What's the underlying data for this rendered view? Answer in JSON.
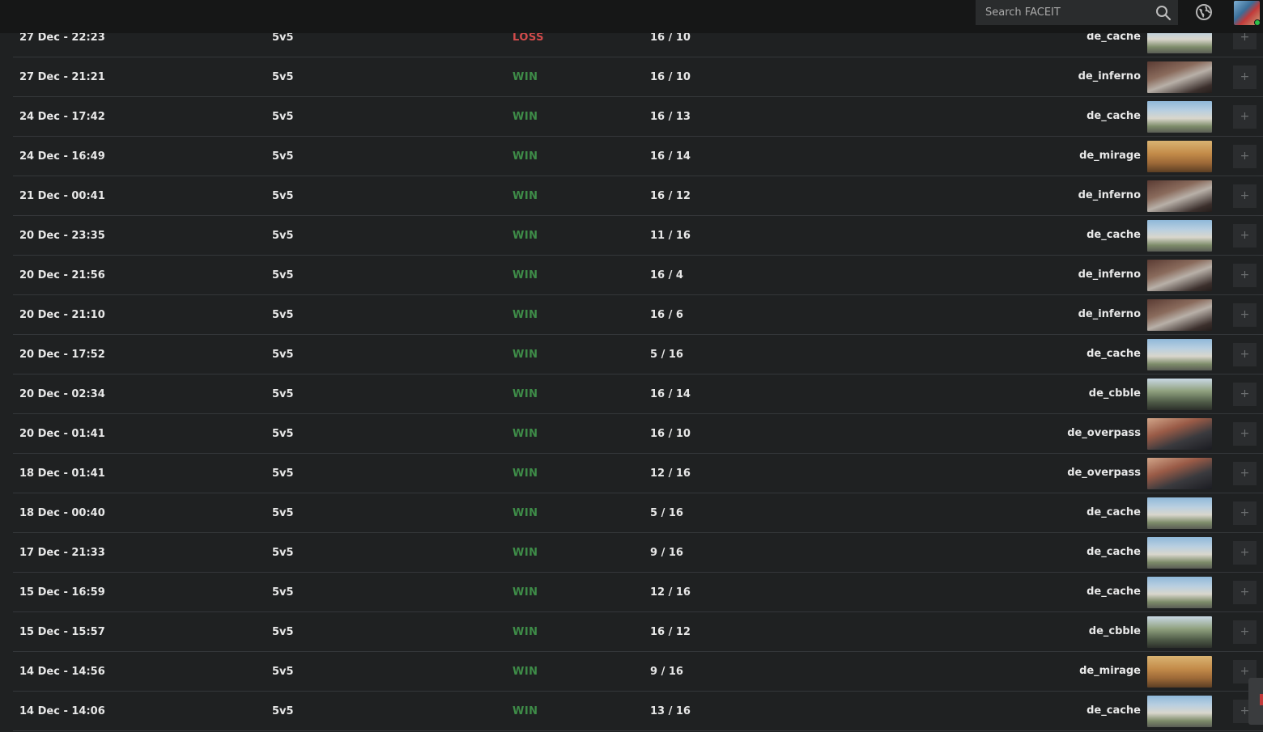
{
  "search": {
    "placeholder": "Search FACEIT"
  },
  "icons": {
    "search": "search-icon",
    "globe": "globe-icon",
    "plus": "plus-icon"
  },
  "colors": {
    "win": "#3e8c48",
    "loss": "#d24b4b"
  },
  "matches": [
    {
      "date": "27 Dec - 22:23",
      "mode": "5v5",
      "result": "LOSS",
      "score": "16 / 10",
      "map": "de_cache",
      "plus": "+"
    },
    {
      "date": "27 Dec - 21:21",
      "mode": "5v5",
      "result": "WIN",
      "score": "16 / 10",
      "map": "de_inferno",
      "plus": "+"
    },
    {
      "date": "24 Dec - 17:42",
      "mode": "5v5",
      "result": "WIN",
      "score": "16 / 13",
      "map": "de_cache",
      "plus": "+"
    },
    {
      "date": "24 Dec - 16:49",
      "mode": "5v5",
      "result": "WIN",
      "score": "16 / 14",
      "map": "de_mirage",
      "plus": "+"
    },
    {
      "date": "21 Dec - 00:41",
      "mode": "5v5",
      "result": "WIN",
      "score": "16 / 12",
      "map": "de_inferno",
      "plus": "+"
    },
    {
      "date": "20 Dec - 23:35",
      "mode": "5v5",
      "result": "WIN",
      "score": "11 / 16",
      "map": "de_cache",
      "plus": "+"
    },
    {
      "date": "20 Dec - 21:56",
      "mode": "5v5",
      "result": "WIN",
      "score": "16 / 4",
      "map": "de_inferno",
      "plus": "+"
    },
    {
      "date": "20 Dec - 21:10",
      "mode": "5v5",
      "result": "WIN",
      "score": "16 / 6",
      "map": "de_inferno",
      "plus": "+"
    },
    {
      "date": "20 Dec - 17:52",
      "mode": "5v5",
      "result": "WIN",
      "score": "5 / 16",
      "map": "de_cache",
      "plus": "+"
    },
    {
      "date": "20 Dec - 02:34",
      "mode": "5v5",
      "result": "WIN",
      "score": "16 / 14",
      "map": "de_cbble",
      "plus": "+"
    },
    {
      "date": "20 Dec - 01:41",
      "mode": "5v5",
      "result": "WIN",
      "score": "16 / 10",
      "map": "de_overpass",
      "plus": "+"
    },
    {
      "date": "18 Dec - 01:41",
      "mode": "5v5",
      "result": "WIN",
      "score": "12 / 16",
      "map": "de_overpass",
      "plus": "+"
    },
    {
      "date": "18 Dec - 00:40",
      "mode": "5v5",
      "result": "WIN",
      "score": "5 / 16",
      "map": "de_cache",
      "plus": "+"
    },
    {
      "date": "17 Dec - 21:33",
      "mode": "5v5",
      "result": "WIN",
      "score": "9 / 16",
      "map": "de_cache",
      "plus": "+"
    },
    {
      "date": "15 Dec - 16:59",
      "mode": "5v5",
      "result": "WIN",
      "score": "12 / 16",
      "map": "de_cache",
      "plus": "+"
    },
    {
      "date": "15 Dec - 15:57",
      "mode": "5v5",
      "result": "WIN",
      "score": "16 / 12",
      "map": "de_cbble",
      "plus": "+"
    },
    {
      "date": "14 Dec - 14:56",
      "mode": "5v5",
      "result": "WIN",
      "score": "9 / 16",
      "map": "de_mirage",
      "plus": "+"
    },
    {
      "date": "14 Dec - 14:06",
      "mode": "5v5",
      "result": "WIN",
      "score": "13 / 16",
      "map": "de_cache",
      "plus": "+"
    }
  ]
}
